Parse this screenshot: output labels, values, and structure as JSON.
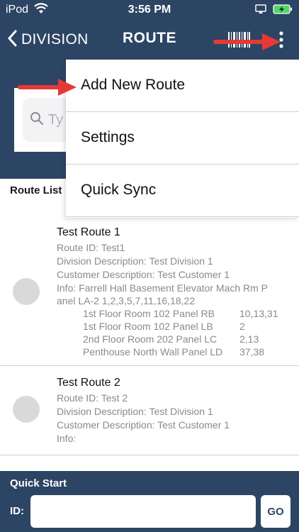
{
  "status_bar": {
    "carrier": "iPod",
    "time": "3:56 PM"
  },
  "nav": {
    "back_label": "DIVISION",
    "title": "ROUTE"
  },
  "search": {
    "placeholder": "Ty"
  },
  "route_list_label": "Route List",
  "menu": {
    "items": [
      "Add New Route",
      "Settings",
      "Quick Sync"
    ]
  },
  "routes": [
    {
      "name": "Test Route 1",
      "route_id": "Route ID: Test1",
      "division": "Division Description: Test Division 1",
      "customer": "Customer Description: Test Customer 1",
      "info_line1": "Info: Farrell Hall Basement Elevator Mach Rm P",
      "info_line2": "anel LA-2  1,2,3,5,7,11,16,18,22",
      "info_rows": [
        {
          "panel": "1st Floor Room 102 Panel RB",
          "values": "10,13,31"
        },
        {
          "panel": "1st Floor Room 102 Panel LB",
          "values": "2"
        },
        {
          "panel": "2nd Floor Room 202 Panel LC",
          "values": "2,13"
        },
        {
          "panel": "Penthouse North Wall Panel LD",
          "values": "37,38"
        }
      ]
    },
    {
      "name": "Test Route 2",
      "route_id": "Route ID: Test 2",
      "division": "Division Description: Test Division 1",
      "customer": "Customer Description: Test Customer 1",
      "info_line1": "Info:"
    }
  ],
  "quick_start": {
    "title": "Quick Start",
    "id_label": "ID:",
    "input_value": "",
    "go_label": "GO"
  },
  "colors": {
    "navy": "#2d4564",
    "annotation_red": "#e53935"
  }
}
